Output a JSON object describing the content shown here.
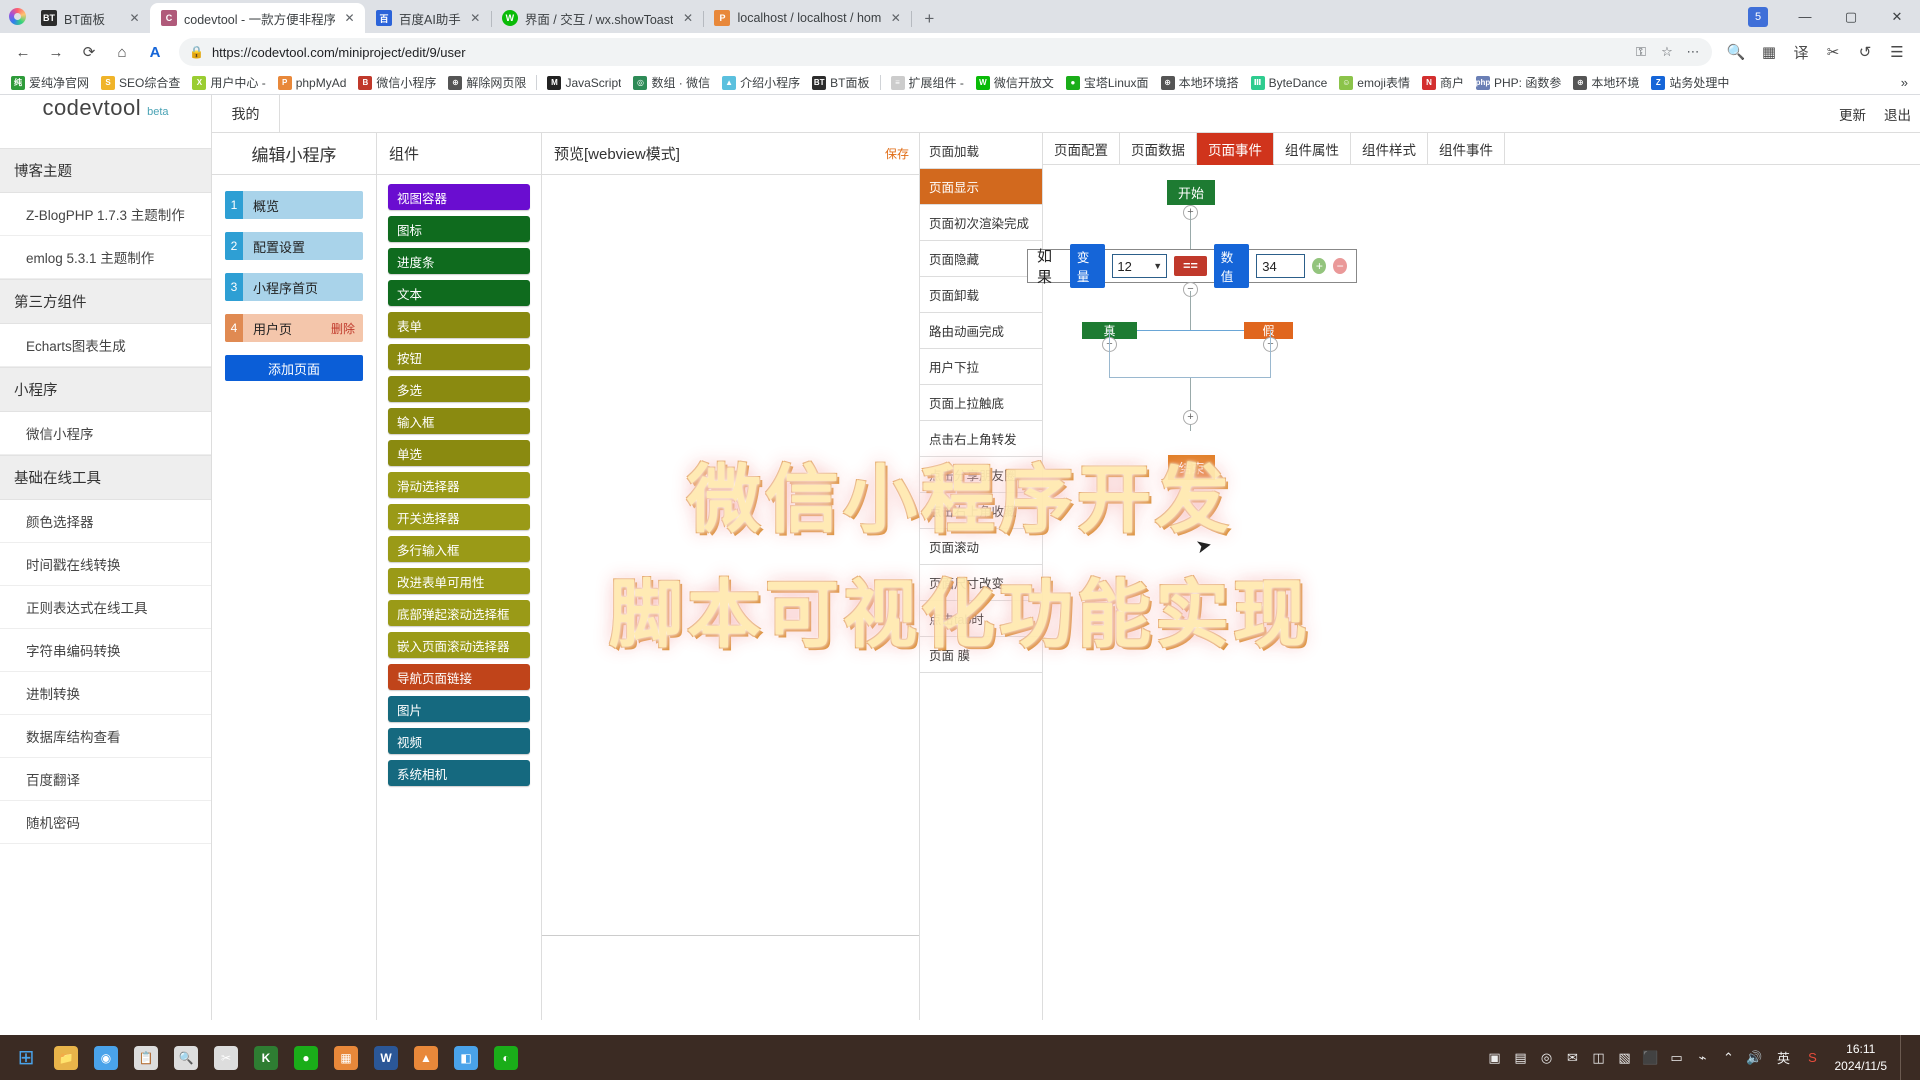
{
  "browser": {
    "tabs": [
      {
        "title": "BT面板",
        "favicon_label": "BT",
        "favicon_color": "#2c2c2c",
        "active": false
      },
      {
        "title": "codevtool - 一款方便非程序",
        "favicon_label": "C",
        "favicon_color": "#b05a7a",
        "active": true
      },
      {
        "title": "百度AI助手",
        "favicon_label": "百",
        "favicon_color": "#2b63d9",
        "active": false
      },
      {
        "title": "界面 / 交互 / wx.showToast",
        "favicon_label": "W",
        "favicon_color": "#09bb07",
        "active": false
      },
      {
        "title": "localhost / localhost / hom",
        "favicon_label": "P",
        "favicon_color": "#e8883a",
        "active": false
      }
    ],
    "tab_close_label": "✕",
    "new_tab_label": "+",
    "window": {
      "profile_badge": "5",
      "minimize": "—",
      "maximize": "▢",
      "close": "✕"
    },
    "toolbar": {
      "back": "←",
      "forward": "→",
      "reload": "⟳",
      "home": "⌂",
      "assistant": "A",
      "lock_icon": "🔒",
      "url": "https://codevtool.com/miniproject/edit/9/user",
      "key_icon": "⚿",
      "star_icon": "☆",
      "more_icon": "⋯",
      "search_icon": "🔍",
      "apps_icon": "▦",
      "translate_icon": "译",
      "cut_icon": "✂",
      "history_icon": "↺",
      "menu_icon": "☰"
    },
    "bookmarks": [
      {
        "label": "爱纯净官网",
        "icon": "纯",
        "color": "#2e9b3a"
      },
      {
        "label": "SEO综合查",
        "icon": "S",
        "color": "#f0b429"
      },
      {
        "label": "用户中心 -",
        "icon": "X",
        "color": "#9acd32"
      },
      {
        "label": "phpMyAd",
        "icon": "P",
        "color": "#e8883a"
      },
      {
        "label": "微信小程序",
        "icon": "B",
        "color": "#c0392b"
      },
      {
        "label": "解除网页限",
        "icon": "⊕",
        "color": "#555555"
      },
      {
        "label": "JavaScript",
        "icon": "M",
        "color": "#222222"
      },
      {
        "label": "数组 · 微信",
        "icon": "◎",
        "color": "#2e8b57"
      },
      {
        "label": "介绍小程序",
        "icon": "▲",
        "color": "#5bc0de"
      },
      {
        "label": "BT面板",
        "icon": "BT",
        "color": "#2c2c2c"
      },
      {
        "label": "扩展组件 -",
        "icon": "≡",
        "color": "#cccccc"
      },
      {
        "label": "微信开放文",
        "icon": "W",
        "color": "#09bb07"
      },
      {
        "label": "宝塔Linux面",
        "icon": "●",
        "color": "#1aad19"
      },
      {
        "label": "本地环境搭",
        "icon": "⊕",
        "color": "#555555"
      },
      {
        "label": "ByteDance",
        "icon": "Ⅲ",
        "color": "#2ecc8f"
      },
      {
        "label": "emoji表情",
        "icon": "☺",
        "color": "#8bc34a"
      },
      {
        "label": "商户",
        "icon": "N",
        "color": "#d32f2f"
      },
      {
        "label": "PHP: 函数参",
        "icon": "php",
        "color": "#6a7fb5"
      },
      {
        "label": "本地环境",
        "icon": "⊕",
        "color": "#555555"
      },
      {
        "label": "站务处理中",
        "icon": "Z",
        "color": "#1565d8"
      }
    ],
    "bookmarks_overflow": "»"
  },
  "sidebar": {
    "logo": "codevtool",
    "beta": "beta",
    "sections": [
      {
        "title": "博客主题",
        "items": [
          "Z-BlogPHP 1.7.3 主题制作",
          "emlog 5.3.1 主题制作"
        ]
      },
      {
        "title": "第三方组件",
        "items": [
          "Echarts图表生成"
        ]
      },
      {
        "title": "小程序",
        "items": [
          "微信小程序"
        ]
      },
      {
        "title": "基础在线工具",
        "items": [
          "颜色选择器",
          "时间戳在线转换",
          "正则表达式在线工具",
          "字符串编码转换",
          "进制转换",
          "数据库结构查看",
          "百度翻译",
          "随机密码"
        ]
      }
    ]
  },
  "app_topbar": {
    "my_tab": "我的",
    "update": "更新",
    "logout": "退出"
  },
  "pages_panel": {
    "title": "编辑小程序",
    "items": [
      {
        "num": "1",
        "label": "概览",
        "style": "blue",
        "delete": ""
      },
      {
        "num": "2",
        "label": "配置设置",
        "style": "blue",
        "delete": ""
      },
      {
        "num": "3",
        "label": "小程序首页",
        "style": "blue",
        "delete": ""
      },
      {
        "num": "4",
        "label": "用户页",
        "style": "orange",
        "delete": "删除"
      }
    ],
    "add_button": "添加页面"
  },
  "components_panel": {
    "title": "组件",
    "items": [
      {
        "label": "视图容器",
        "color": "#6a0dd0"
      },
      {
        "label": "图标",
        "color": "#0f6b1e"
      },
      {
        "label": "进度条",
        "color": "#0f6b1e"
      },
      {
        "label": "文本",
        "color": "#0f6b1e"
      },
      {
        "label": "表单",
        "color": "#8a8a10"
      },
      {
        "label": "按钮",
        "color": "#8a8a10"
      },
      {
        "label": "多选",
        "color": "#8a8a10"
      },
      {
        "label": "输入框",
        "color": "#8a8a10"
      },
      {
        "label": "单选",
        "color": "#8a8a10"
      },
      {
        "label": "滑动选择器",
        "color": "#9a9a17"
      },
      {
        "label": "开关选择器",
        "color": "#9a9a17"
      },
      {
        "label": "多行输入框",
        "color": "#9a9a17"
      },
      {
        "label": "改进表单可用性",
        "color": "#9a9a17"
      },
      {
        "label": "底部弹起滚动选择框",
        "color": "#9a9a17"
      },
      {
        "label": "嵌入页面滚动选择器",
        "color": "#9a9a17"
      },
      {
        "label": "导航页面链接",
        "color": "#c0441a"
      },
      {
        "label": "图片",
        "color": "#15697f"
      },
      {
        "label": "视频",
        "color": "#15697f"
      },
      {
        "label": "系统相机",
        "color": "#15697f"
      }
    ]
  },
  "preview_panel": {
    "title": "预览[webview模式]",
    "save": "保存"
  },
  "events_panel": {
    "items": [
      {
        "label": "页面加载",
        "selected": false
      },
      {
        "label": "页面显示",
        "selected": true
      },
      {
        "label": "页面初次渲染完成",
        "selected": false
      },
      {
        "label": "页面隐藏",
        "selected": false
      },
      {
        "label": "页面卸载",
        "selected": false
      },
      {
        "label": "路由动画完成",
        "selected": false
      },
      {
        "label": "用户下拉",
        "selected": false
      },
      {
        "label": "页面上拉触底",
        "selected": false
      },
      {
        "label": "点击右上角转发",
        "selected": false
      },
      {
        "label": "点击分享朋友圈",
        "selected": false
      },
      {
        "label": "点击右上角收藏",
        "selected": false
      },
      {
        "label": "页面滚动",
        "selected": false
      },
      {
        "label": "页面尺寸改变",
        "selected": false
      },
      {
        "label": "点击tab时",
        "selected": false
      },
      {
        "label": "页面 膜",
        "selected": false
      }
    ]
  },
  "flow_tabs": [
    {
      "label": "页面配置",
      "active": false
    },
    {
      "label": "页面数据",
      "active": false
    },
    {
      "label": "页面事件",
      "active": true
    },
    {
      "label": "组件属性",
      "active": false
    },
    {
      "label": "组件样式",
      "active": false
    },
    {
      "label": "组件事件",
      "active": false
    }
  ],
  "flowchart": {
    "start_node": "开始",
    "end_node": "结束",
    "true_node": "真",
    "false_node": "假",
    "condition": {
      "if_label": "如果",
      "left_type": "变量",
      "left_value": "12",
      "operator": "==",
      "right_type": "数值",
      "right_value": "34",
      "add_icon": "+",
      "remove_icon": "−"
    },
    "plus_icon": "+",
    "minus_icon": "−"
  },
  "watermark": {
    "line1": "微信小程序开发",
    "line2": "脚本可视化功能实现"
  },
  "taskbar": {
    "start_icon": "⊞",
    "icons": [
      {
        "glyph": "📁",
        "color": "#e8b44a"
      },
      {
        "glyph": "◉",
        "color": "#4aa3ea"
      },
      {
        "glyph": "📋",
        "color": "#ddd"
      },
      {
        "glyph": "🔍",
        "color": "#ddd"
      },
      {
        "glyph": "✂",
        "color": "#ddd"
      },
      {
        "glyph": "K",
        "color": "#2e7d32"
      },
      {
        "glyph": "●",
        "color": "#1aad19"
      },
      {
        "glyph": "▦",
        "color": "#e8883a"
      },
      {
        "glyph": "W",
        "color": "#2b5797"
      },
      {
        "glyph": "▲",
        "color": "#e8883a"
      },
      {
        "glyph": "◧",
        "color": "#4aa3ea"
      },
      {
        "glyph": "◐",
        "color": "#1aad19"
      }
    ],
    "tray": [
      "▣",
      "▤",
      "◎",
      "✉",
      "◫",
      "▧",
      "⬛",
      "▭",
      "⌁",
      "⌃",
      "🔊"
    ],
    "ime": "英",
    "time": "16:11",
    "date": "2024/11/5"
  }
}
